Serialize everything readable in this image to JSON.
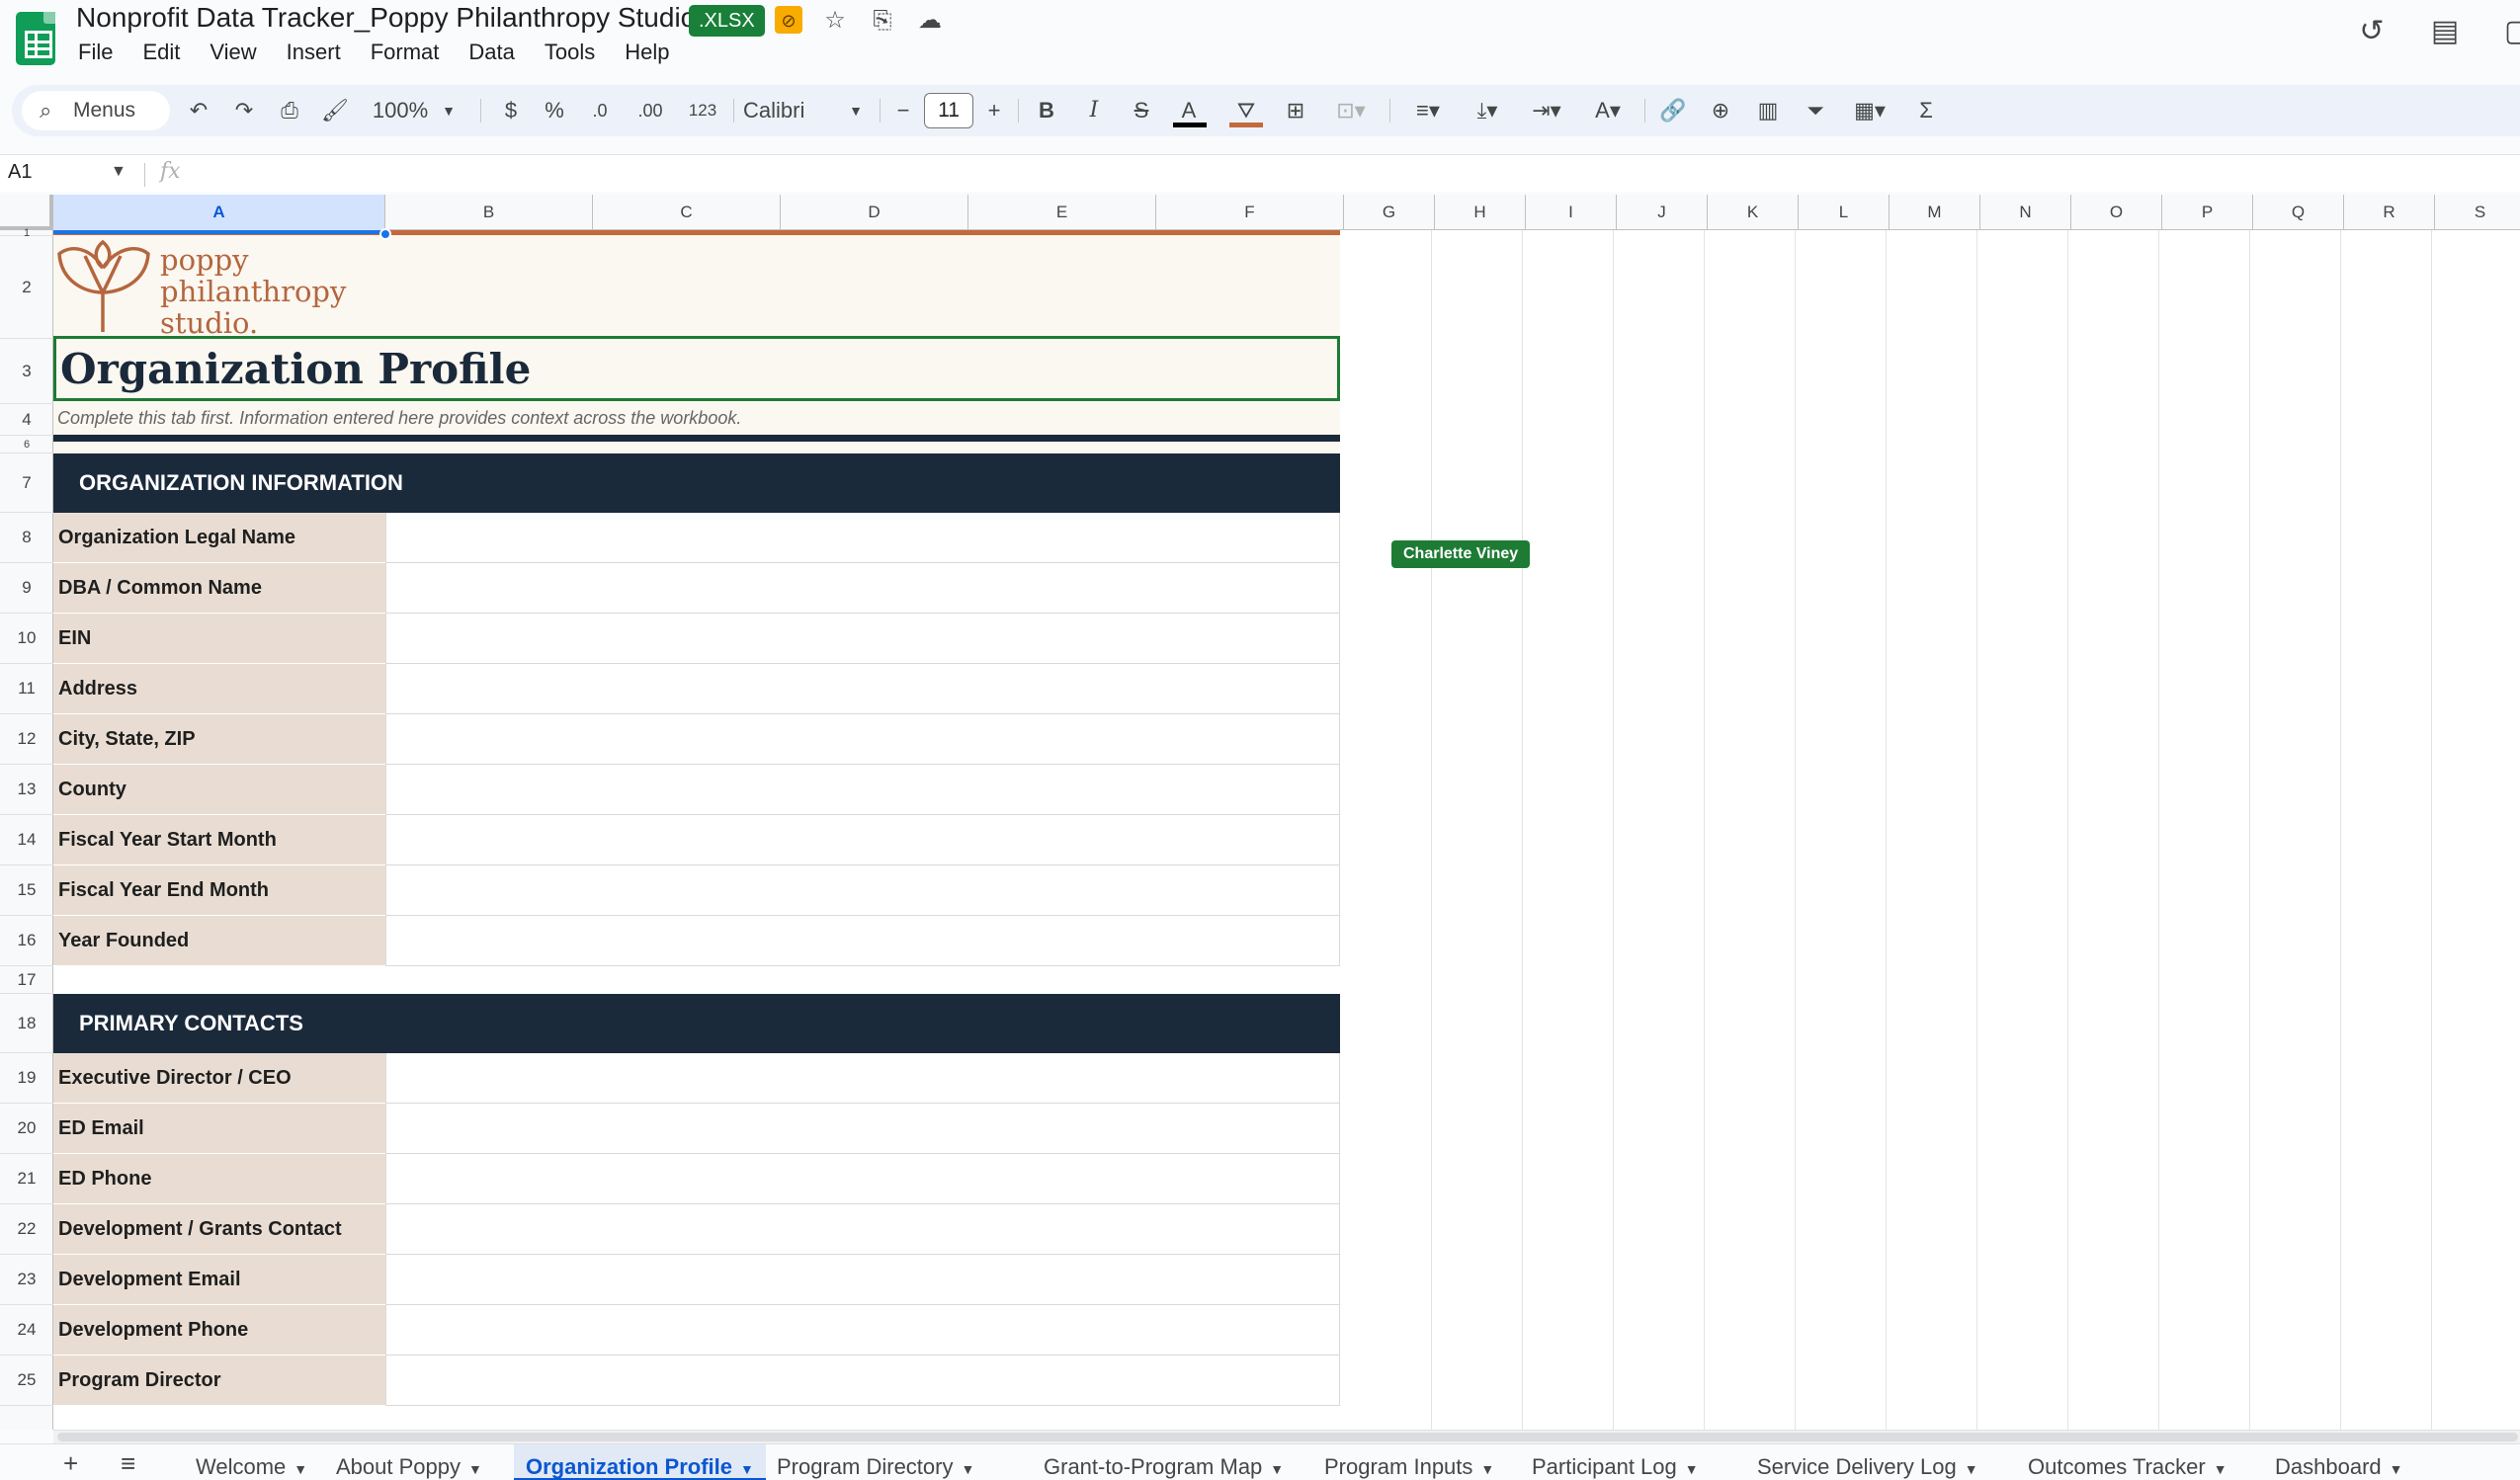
{
  "app": {
    "doc_title": "Nonprofit Data Tracker_Poppy Philanthropy Studio",
    "file_badge": ".XLSX",
    "menus": [
      "File",
      "Edit",
      "View",
      "Insert",
      "Format",
      "Data",
      "Tools",
      "Help"
    ]
  },
  "toolbar": {
    "search_label": "Menus",
    "zoom": "100%",
    "currency": "$",
    "percent": "%",
    "dec_decrease": ".0",
    "dec_increase": ".00",
    "number_format": "123",
    "font": "Calibri",
    "font_size": "11",
    "minus": "−",
    "plus": "+",
    "bold": "B",
    "italic": "I",
    "strike": "S",
    "text_color": "A",
    "text_color_hex": "#000000",
    "fill_color_hex": "#c4693b",
    "sum": "Σ"
  },
  "formula_bar": {
    "name_box": "A1",
    "fx": "fx",
    "value": ""
  },
  "columns": [
    "A",
    "B",
    "C",
    "D",
    "E",
    "F",
    "G",
    "H",
    "I",
    "J",
    "K",
    "L",
    "M",
    "N",
    "O",
    "P",
    "Q",
    "R",
    "S"
  ],
  "rows": [
    "1",
    "2",
    "3",
    "4",
    "6",
    "7",
    "8",
    "9",
    "10",
    "11",
    "12",
    "13",
    "14",
    "15",
    "16",
    "17",
    "18",
    "19",
    "20",
    "21",
    "22",
    "23",
    "24",
    "25"
  ],
  "sheet": {
    "logo_text": [
      "poppy",
      "philanthropy",
      "studio."
    ],
    "title": "Organization Profile",
    "subtitle": "Complete this tab first. Information entered here provides context across the workbook.",
    "sections": [
      {
        "header": "ORGANIZATION INFORMATION",
        "fields": [
          "Organization Legal Name",
          "DBA / Common Name",
          "EIN",
          "Address",
          "City, State, ZIP",
          "County",
          "Fiscal Year Start Month",
          "Fiscal Year End Month",
          "Year Founded"
        ]
      },
      {
        "header": "PRIMARY CONTACTS",
        "fields": [
          "Executive Director / CEO",
          "ED Email",
          "ED Phone",
          "Development / Grants Contact",
          "Development Email",
          "Development Phone",
          "Program Director"
        ]
      }
    ],
    "collaborator": "Charlette Viney"
  },
  "tabs": [
    {
      "label": "Welcome",
      "active": false
    },
    {
      "label": "About Poppy",
      "active": false
    },
    {
      "label": "Organization Profile",
      "active": true
    },
    {
      "label": "Program Directory",
      "active": false
    },
    {
      "label": "Grant-to-Program Map",
      "active": false
    },
    {
      "label": "Program Inputs",
      "active": false
    },
    {
      "label": "Participant Log",
      "active": false
    },
    {
      "label": "Service Delivery Log",
      "active": false
    },
    {
      "label": "Outcomes Tracker",
      "active": false
    },
    {
      "label": "Dashboard",
      "active": false
    }
  ],
  "colors": {
    "navy": "#1b2a3b",
    "brand_orange": "#c4693b",
    "label_fill": "#e9ddd3",
    "cream": "#fbf7f1",
    "selection_green": "#1e7b34"
  }
}
